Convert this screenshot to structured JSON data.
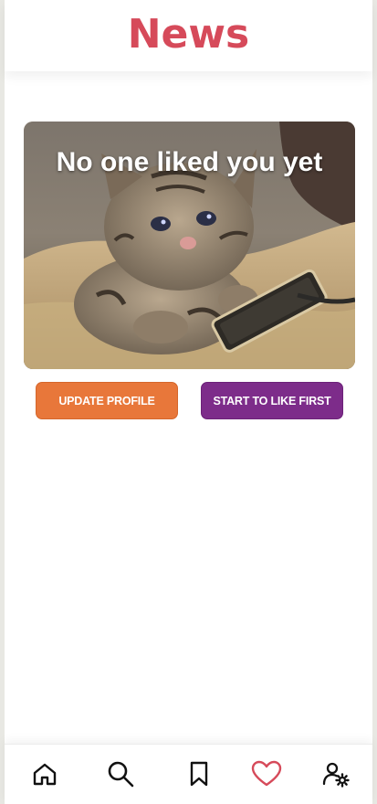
{
  "header": {
    "title": "News"
  },
  "hero": {
    "message": "No one liked you yet",
    "image": "crying-cat-holding-phone"
  },
  "actions": {
    "update_profile": "UPDATE PROFILE",
    "start_to_like": "START TO LIKE FIRST"
  },
  "nav": {
    "items": [
      {
        "icon": "home-icon",
        "active": false
      },
      {
        "icon": "search-icon",
        "active": false
      },
      {
        "icon": "bookmark-icon",
        "active": false
      },
      {
        "icon": "heart-icon",
        "active": true
      },
      {
        "icon": "user-settings-icon",
        "active": false
      }
    ]
  },
  "colors": {
    "brand": "#d64a5a",
    "update_button": "#e8773a",
    "like_button": "#7d2c8a",
    "active_icon": "#d64a5a"
  }
}
